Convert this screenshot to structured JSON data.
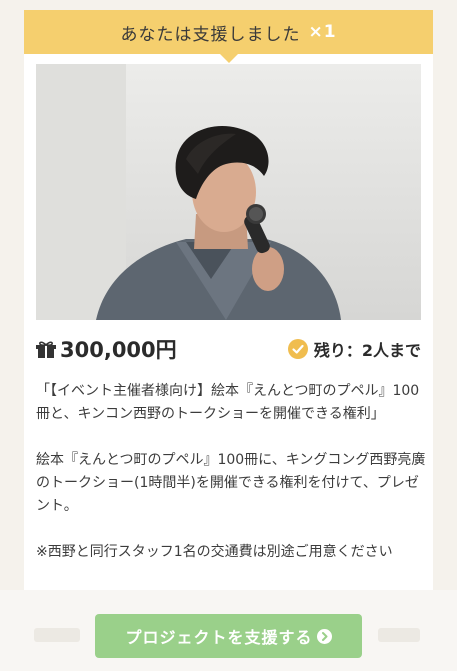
{
  "banner": {
    "text": "あなたは支援しました",
    "count": "×1",
    "color": "#f5cf6e"
  },
  "reward": {
    "price": "300,000円",
    "remaining": "残り：2人まで",
    "icons": {
      "price": "gift-icon",
      "remaining": "check-circle-icon"
    }
  },
  "description": {
    "p1": "「【イベント主催者様向け】絵本『えんとつ町のプペル』100冊と、キンコン西野のトークショーを開催できる権利」",
    "p2": "絵本『えんとつ町のプペル』100冊に、キングコング西野亮廣のトークショー(1時間半)を開催できる権利を付けて、プレゼント。",
    "p3": "※西野と同行スタッフ1名の交通費は別途ご用意ください"
  },
  "cta": {
    "label": "プロジェクトを支援する",
    "icon": "chevron-right-circle-icon",
    "color": "#9ad08a"
  }
}
